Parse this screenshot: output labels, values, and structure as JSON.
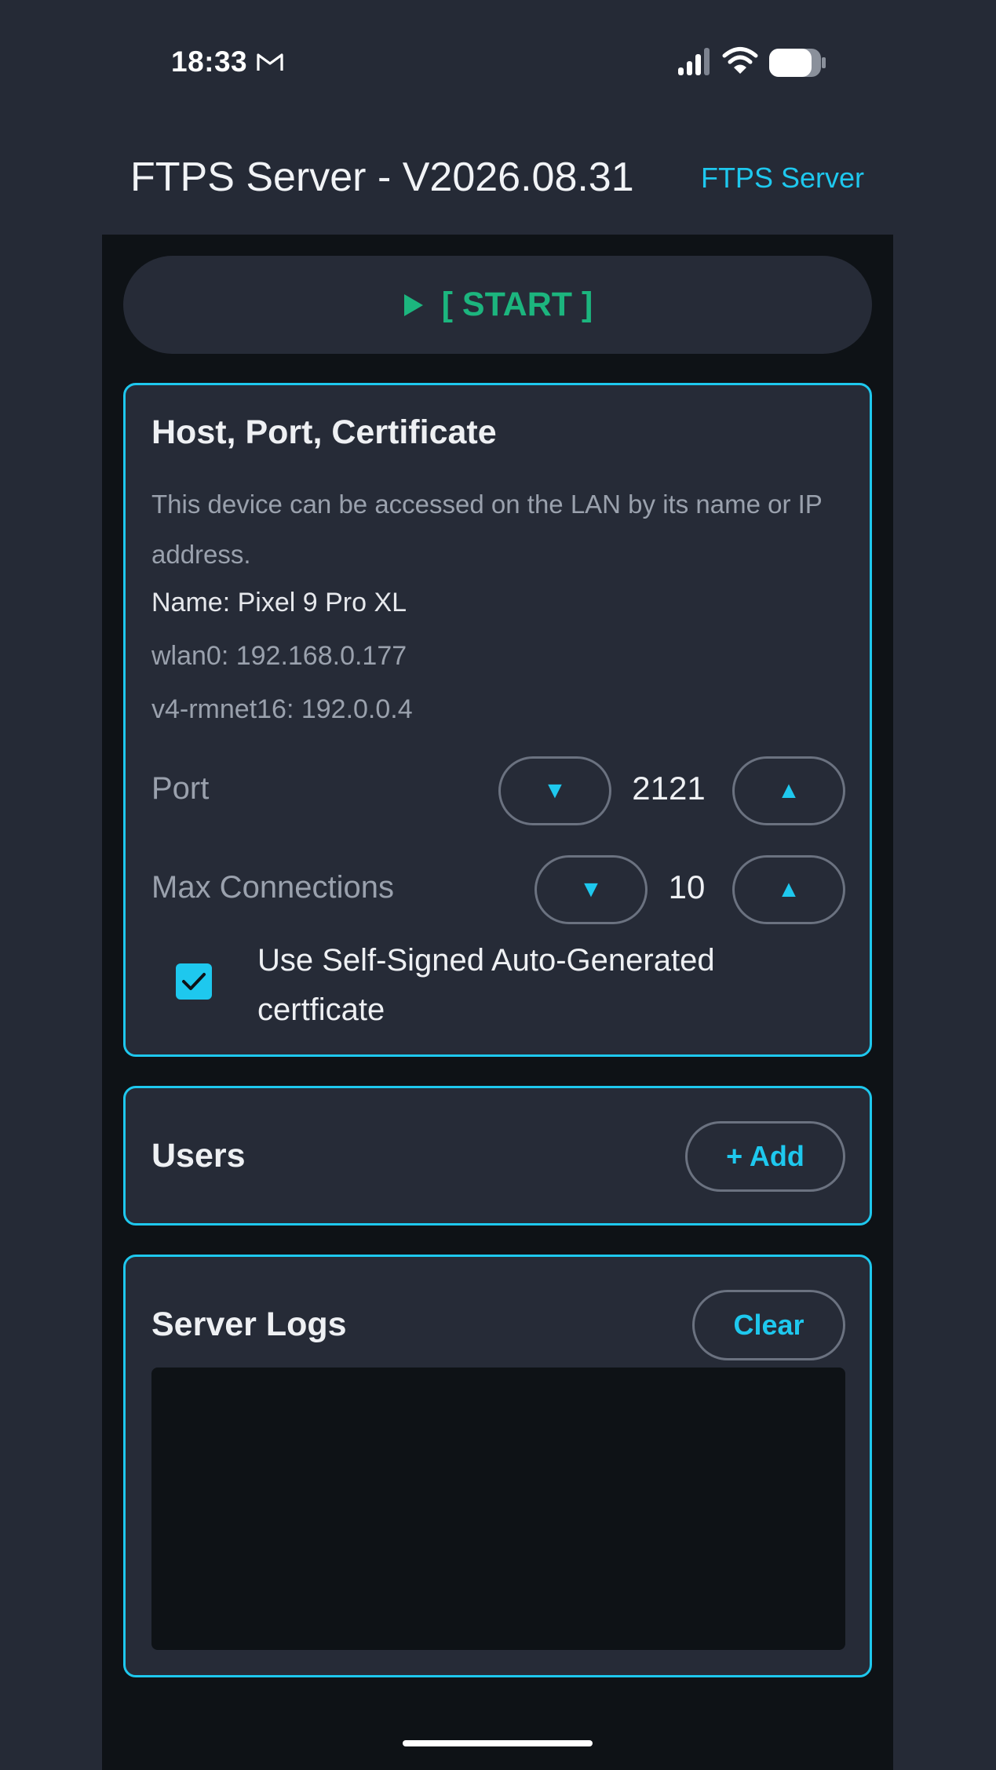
{
  "status_bar": {
    "time": "18:33",
    "icons": [
      "gmail-icon",
      "signal-icon",
      "wifi-icon",
      "battery-icon"
    ]
  },
  "header": {
    "title": "FTPS Server - V2026.08.31",
    "link_label": "FTPS Server"
  },
  "start_button": {
    "icon": "play-icon",
    "label": "[ START ]"
  },
  "host_card": {
    "title": "Host, Port, Certificate",
    "description": "This device can be accessed on the LAN by its name or IP address.",
    "name_line": "Name: Pixel 9 Pro XL",
    "ip_lines": [
      "wlan0: 192.168.0.177",
      "v4-rmnet16: 192.0.0.4"
    ],
    "port": {
      "label": "Port",
      "value": "2121",
      "decrement": "▼",
      "increment": "▲"
    },
    "max_connections": {
      "label": "Max Connections",
      "value": "10",
      "decrement": "▼",
      "increment": "▲"
    },
    "self_signed": {
      "checked": true,
      "label": "Use Self-Signed Auto-Generated certficate"
    }
  },
  "users_card": {
    "title": "Users",
    "add_label": "+ Add"
  },
  "logs_card": {
    "title": "Server Logs",
    "clear_label": "Clear",
    "log_text": ""
  },
  "colors": {
    "background": "#252a36",
    "panel": "#0e1216",
    "card": "#262b37",
    "accent": "#1ec8ee",
    "start_green": "#1cb57e"
  }
}
